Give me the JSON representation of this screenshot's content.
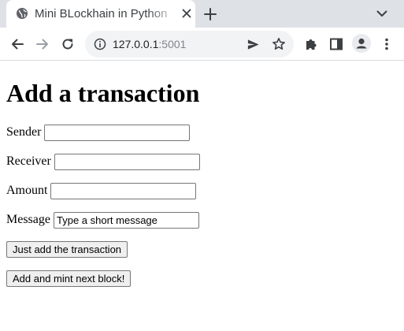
{
  "browser": {
    "tab": {
      "title": "Mini BLockhain in Python",
      "favicon": "globe-icon",
      "close_icon": "close-icon"
    },
    "new_tab_icon": "plus-icon",
    "tab_search_icon": "chevron-down-icon",
    "nav": {
      "back_icon": "arrow-left-icon",
      "forward_icon": "arrow-right-icon",
      "reload_icon": "reload-icon"
    },
    "omnibox": {
      "site_info_icon": "info-icon",
      "host": "127.0.0.1",
      "port": ":5001",
      "send_icon": "send-icon",
      "bookmark_icon": "star-icon"
    },
    "toolbar_icons": [
      "puzzle-icon",
      "side-panel-icon",
      "profile-icon",
      "kebab-menu-icon"
    ]
  },
  "page": {
    "heading": "Add a transaction",
    "form": {
      "sender_label": "Sender",
      "sender_value": "",
      "receiver_label": "Receiver",
      "receiver_value": "",
      "amount_label": "Amount",
      "amount_value": "",
      "message_label": "Message",
      "message_placeholder": "Type a short message",
      "add_button": "Just add the transaction",
      "mint_button": "Add and mint next block!"
    }
  }
}
